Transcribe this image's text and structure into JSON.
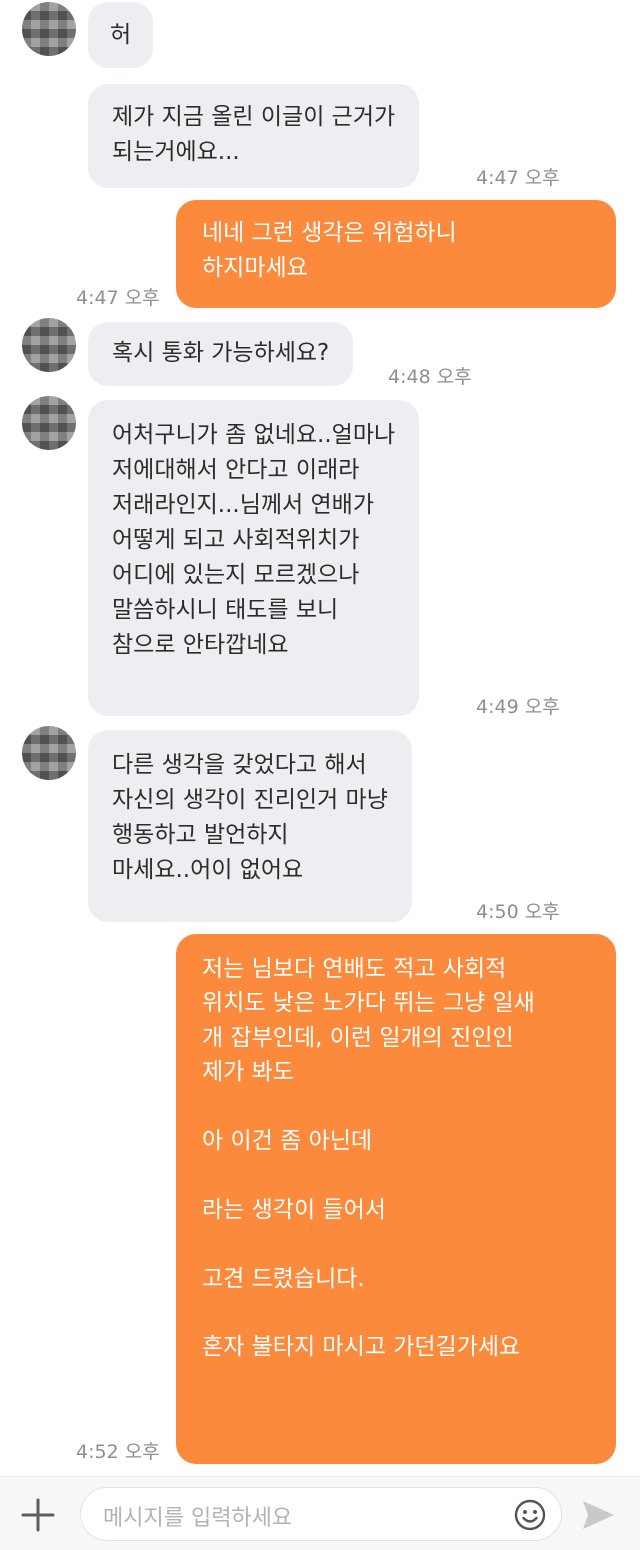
{
  "messages": [
    {
      "from": "them",
      "text": "허",
      "time": ""
    },
    {
      "from": "them",
      "text": "제가 지금 올린 이글이 근거가\n되는거에요...",
      "time": "4:47 오후"
    },
    {
      "from": "me",
      "text": "네네 그런 생각은 위험하니\n하지마세요",
      "time": "4:47 오후"
    },
    {
      "from": "them",
      "text": "혹시 통화 가능하세요?",
      "time": "4:48 오후"
    },
    {
      "from": "them",
      "text": "어처구니가 좀 없네요..얼마나\n저에대해서 안다고 이래라\n저래라인지...님께서 연배가\n어떻게 되고 사회적위치가\n어디에 있는지 모르겠으나\n말씀하시니 태도를 보니\n참으로 안타깝네요",
      "time": "4:49 오후"
    },
    {
      "from": "them",
      "text": "다른 생각을 갖었다고 해서\n자신의 생각이 진리인거 마냥\n행동하고 발언하지\n마세요..어이 없어요",
      "time": "4:50 오후"
    },
    {
      "from": "me",
      "text": "저는 님보다 연배도 적고 사회적\n위치도 낮은 노가다 뛰는 그냥 일새\n개 잡부인데, 이런 일개의 진인인\n제가 봐도\n\n아 이건 좀 아닌데\n\n라는 생각이 들어서\n\n고견 드렸습니다.\n\n혼자 불타지 마시고 가던길가세요",
      "time": "4:52 오후"
    }
  ],
  "composer": {
    "placeholder": "메시지를 입력하세요",
    "plus_icon": "plus-icon",
    "emoji_icon": "smiley-icon",
    "send_icon": "send-icon"
  },
  "colors": {
    "incoming_bubble": "#eceef1",
    "outgoing_bubble": "#fb8a3c",
    "timestamp": "#8f8f8f"
  }
}
